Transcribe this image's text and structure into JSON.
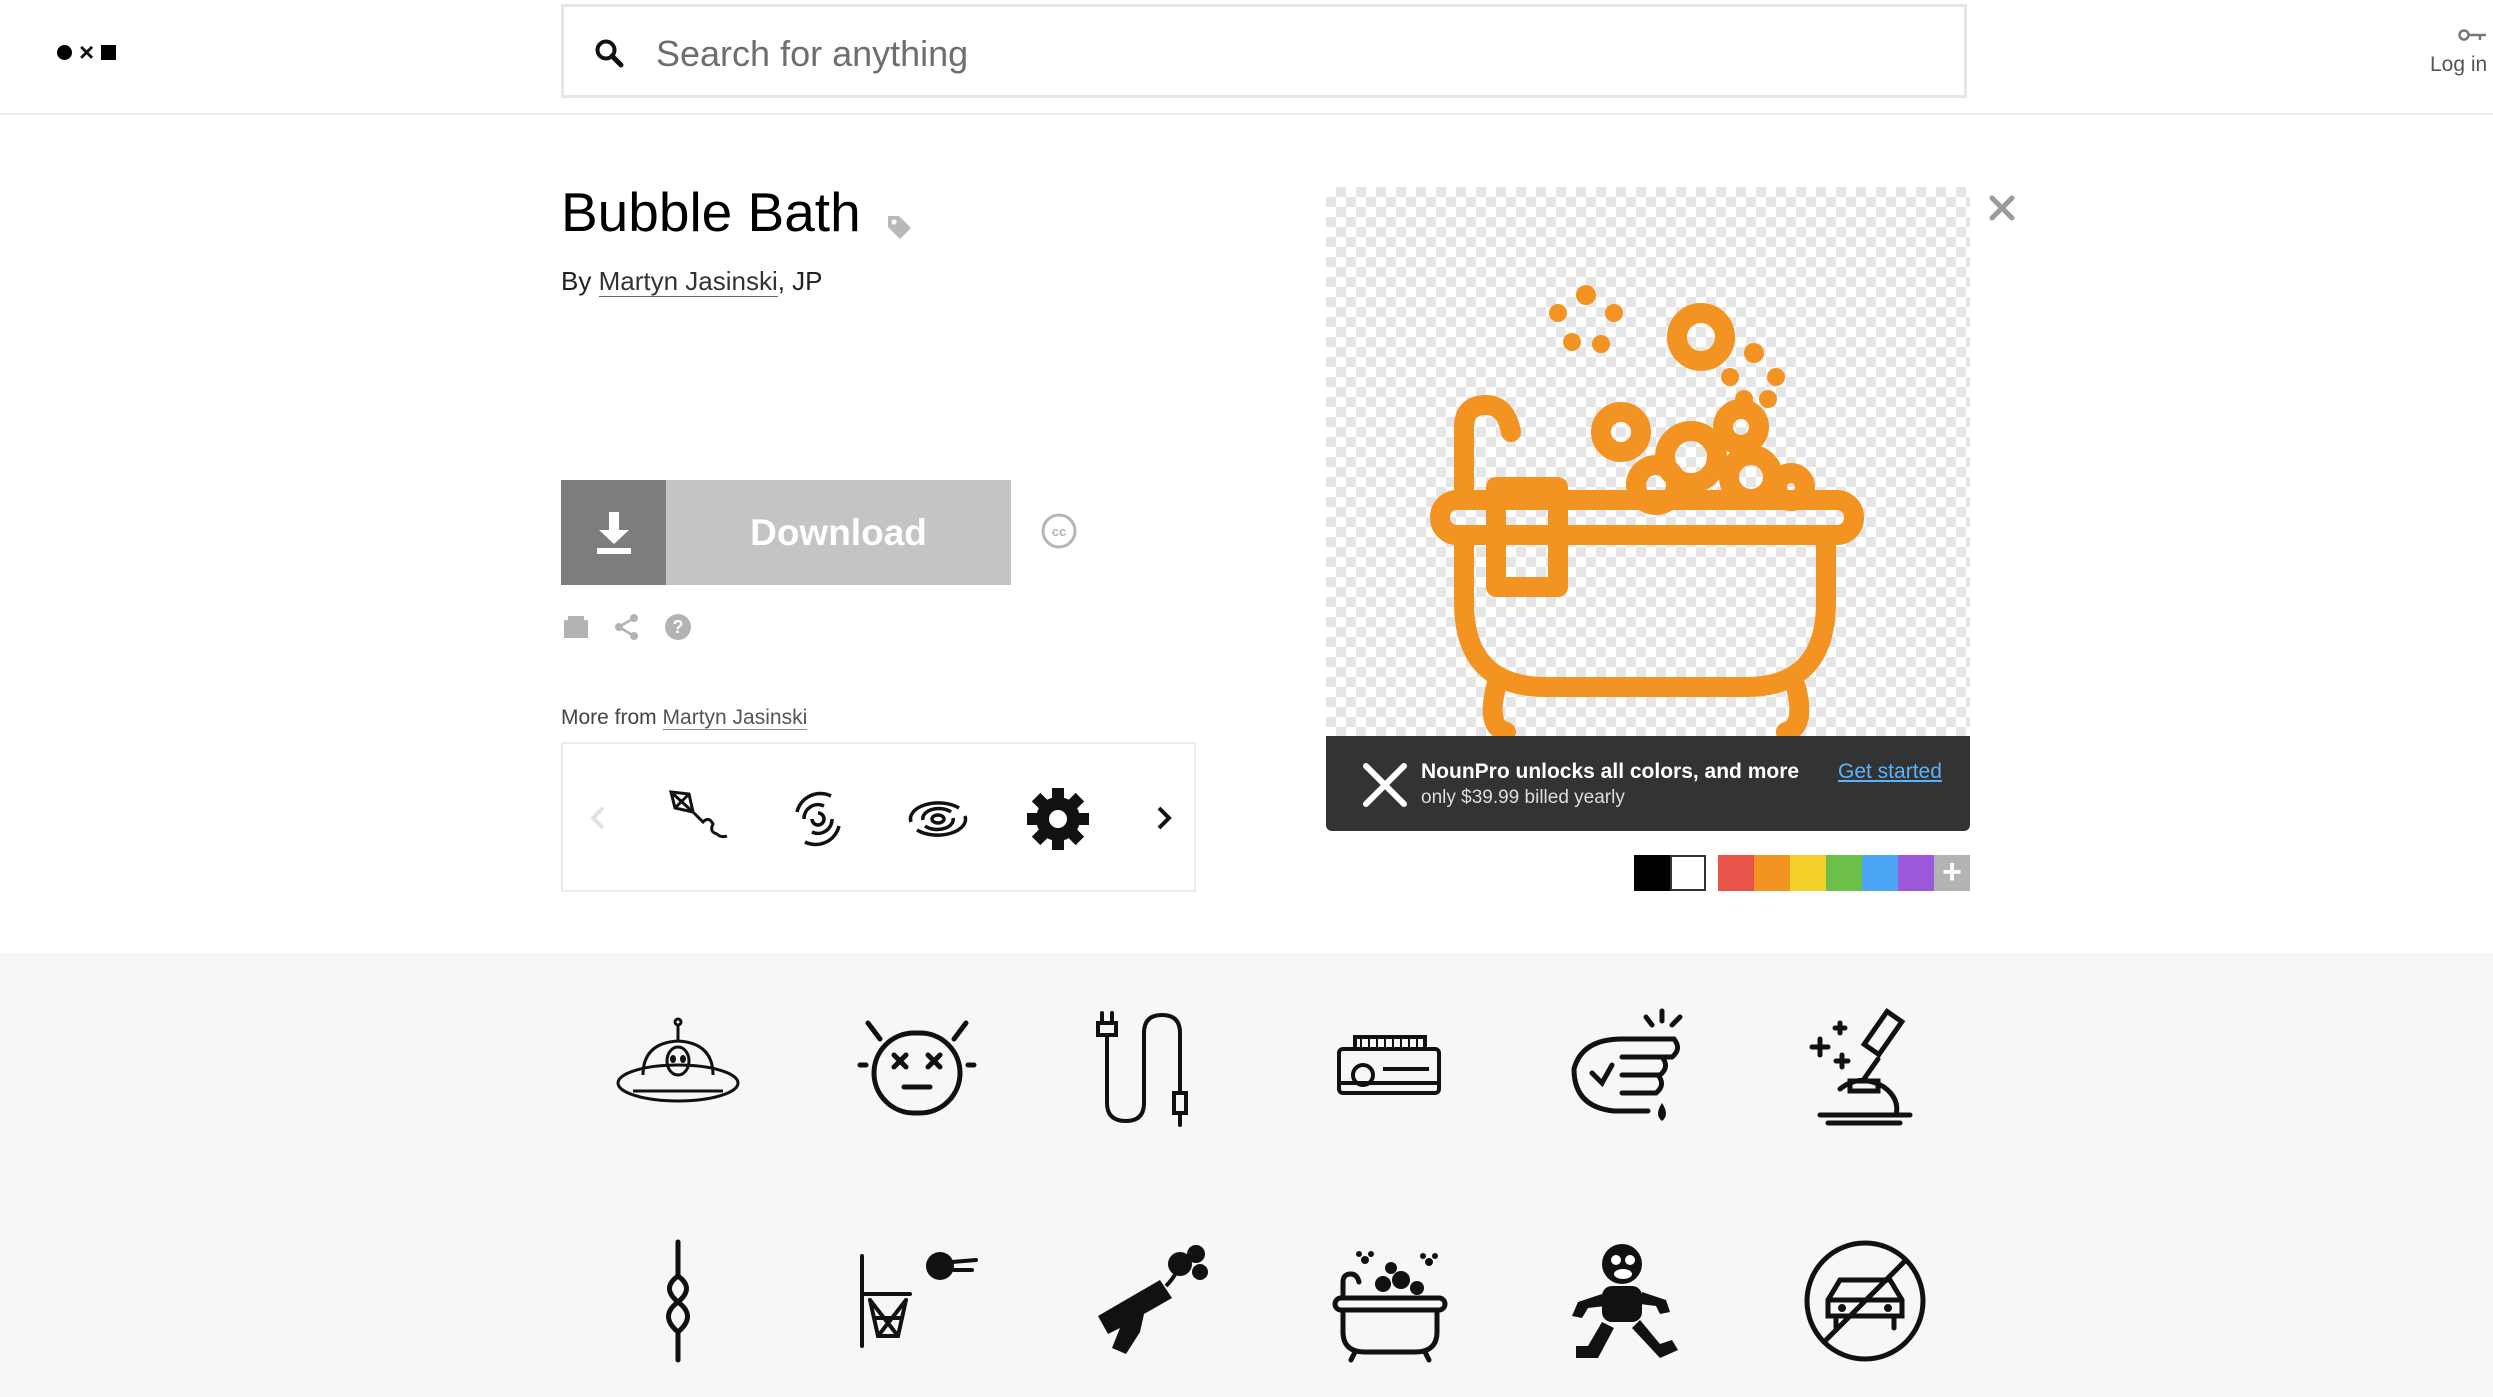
{
  "header": {
    "search_placeholder": "Search for anything",
    "login_label": "Log in"
  },
  "icon": {
    "title": "Bubble Bath",
    "by_prefix": "By",
    "author": "Martyn Jasinski",
    "author_suffix": ", JP",
    "download_label": "Download",
    "license_icon": "creative-commons-icon"
  },
  "more_from": {
    "prefix": "More from",
    "author": "Martyn Jasinski",
    "items": [
      "kite-icon",
      "galaxy-icon",
      "spiral-galaxy-icon",
      "gear-icon"
    ]
  },
  "promo": {
    "line1": "NounPro unlocks all colors, and more",
    "line2": "only $39.99 billed yearly",
    "cta": "Get started"
  },
  "colors": {
    "accent": "#f39321",
    "swatches": [
      "#000000",
      "#ffffff",
      "#e8534a",
      "#f39321",
      "#f5d12b",
      "#6cc04a",
      "#4da6f5",
      "#9b59d9"
    ],
    "plus_swatch": "#b3b3b3"
  },
  "gallery": {
    "row1": [
      "ufo-alien-icon",
      "robot-face-icon",
      "usb-cable-icon",
      "projector-icon",
      "cold-sweat-fist-icon",
      "microscope-icon"
    ],
    "row2": [
      "rope-knot-icon",
      "basketball-hoop-icon",
      "gun-flower-icon",
      "bubble-bath-icon",
      "running-monkey-icon",
      "no-car-icon"
    ]
  }
}
